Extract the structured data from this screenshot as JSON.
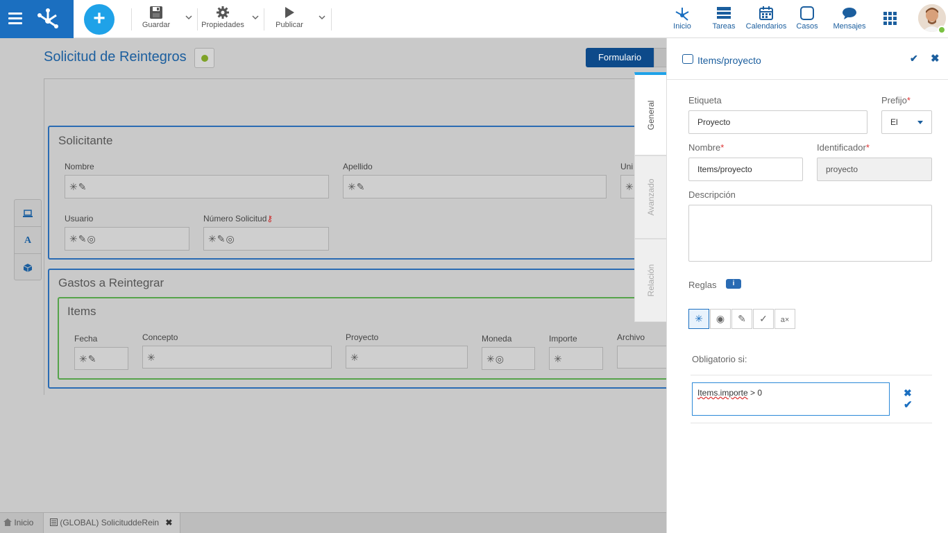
{
  "toolbar": {
    "guardar": "Guardar",
    "propiedades": "Propiedades",
    "publicar": "Publicar"
  },
  "nav": {
    "inicio": "Inicio",
    "tareas": "Tareas",
    "calendarios": "Calendarios",
    "casos": "Casos",
    "mensajes": "Mensajes"
  },
  "page": {
    "title": "Solicitud de Reintegros",
    "form_tab": "Formulario"
  },
  "solicitante": {
    "title": "Solicitante",
    "fields": {
      "nombre": "Nombre",
      "apellido": "Apellido",
      "uni": "Uni",
      "usuario": "Usuario",
      "numero": "Número Solicitud"
    }
  },
  "gastos": {
    "title": "Gastos a Reintegrar",
    "items_title": "Items",
    "cols": {
      "fecha": "Fecha",
      "concepto": "Concepto",
      "proyecto": "Proyecto",
      "moneda": "Moneda",
      "importe": "Importe",
      "archivo": "Archivo"
    }
  },
  "vtabs": {
    "general": "General",
    "avanzado": "Avanzado",
    "relacion": "Relación"
  },
  "panel": {
    "title": "Items/proyecto",
    "etiqueta_label": "Etiqueta",
    "etiqueta_value": "Proyecto",
    "prefijo_label": "Prefijo",
    "prefijo_value": "El",
    "nombre_label": "Nombre",
    "nombre_value": "Items/proyecto",
    "identificador_label": "Identificador",
    "identificador_value": "proyecto",
    "descripcion_label": "Descripción",
    "reglas_label": "Reglas",
    "obligatorio_label": "Obligatorio si:",
    "cond_part1": "Items.importe",
    "cond_part2": " > 0",
    "req_mark": "*"
  },
  "bottom": {
    "inicio": "Inicio",
    "tab": "(GLOBAL) SolicituddeRein"
  },
  "colors": {
    "accent": "#1b6fc0",
    "primary_dark": "#0d4a8a",
    "section_border": "#2a6bb3",
    "items_border": "#55a34a"
  }
}
